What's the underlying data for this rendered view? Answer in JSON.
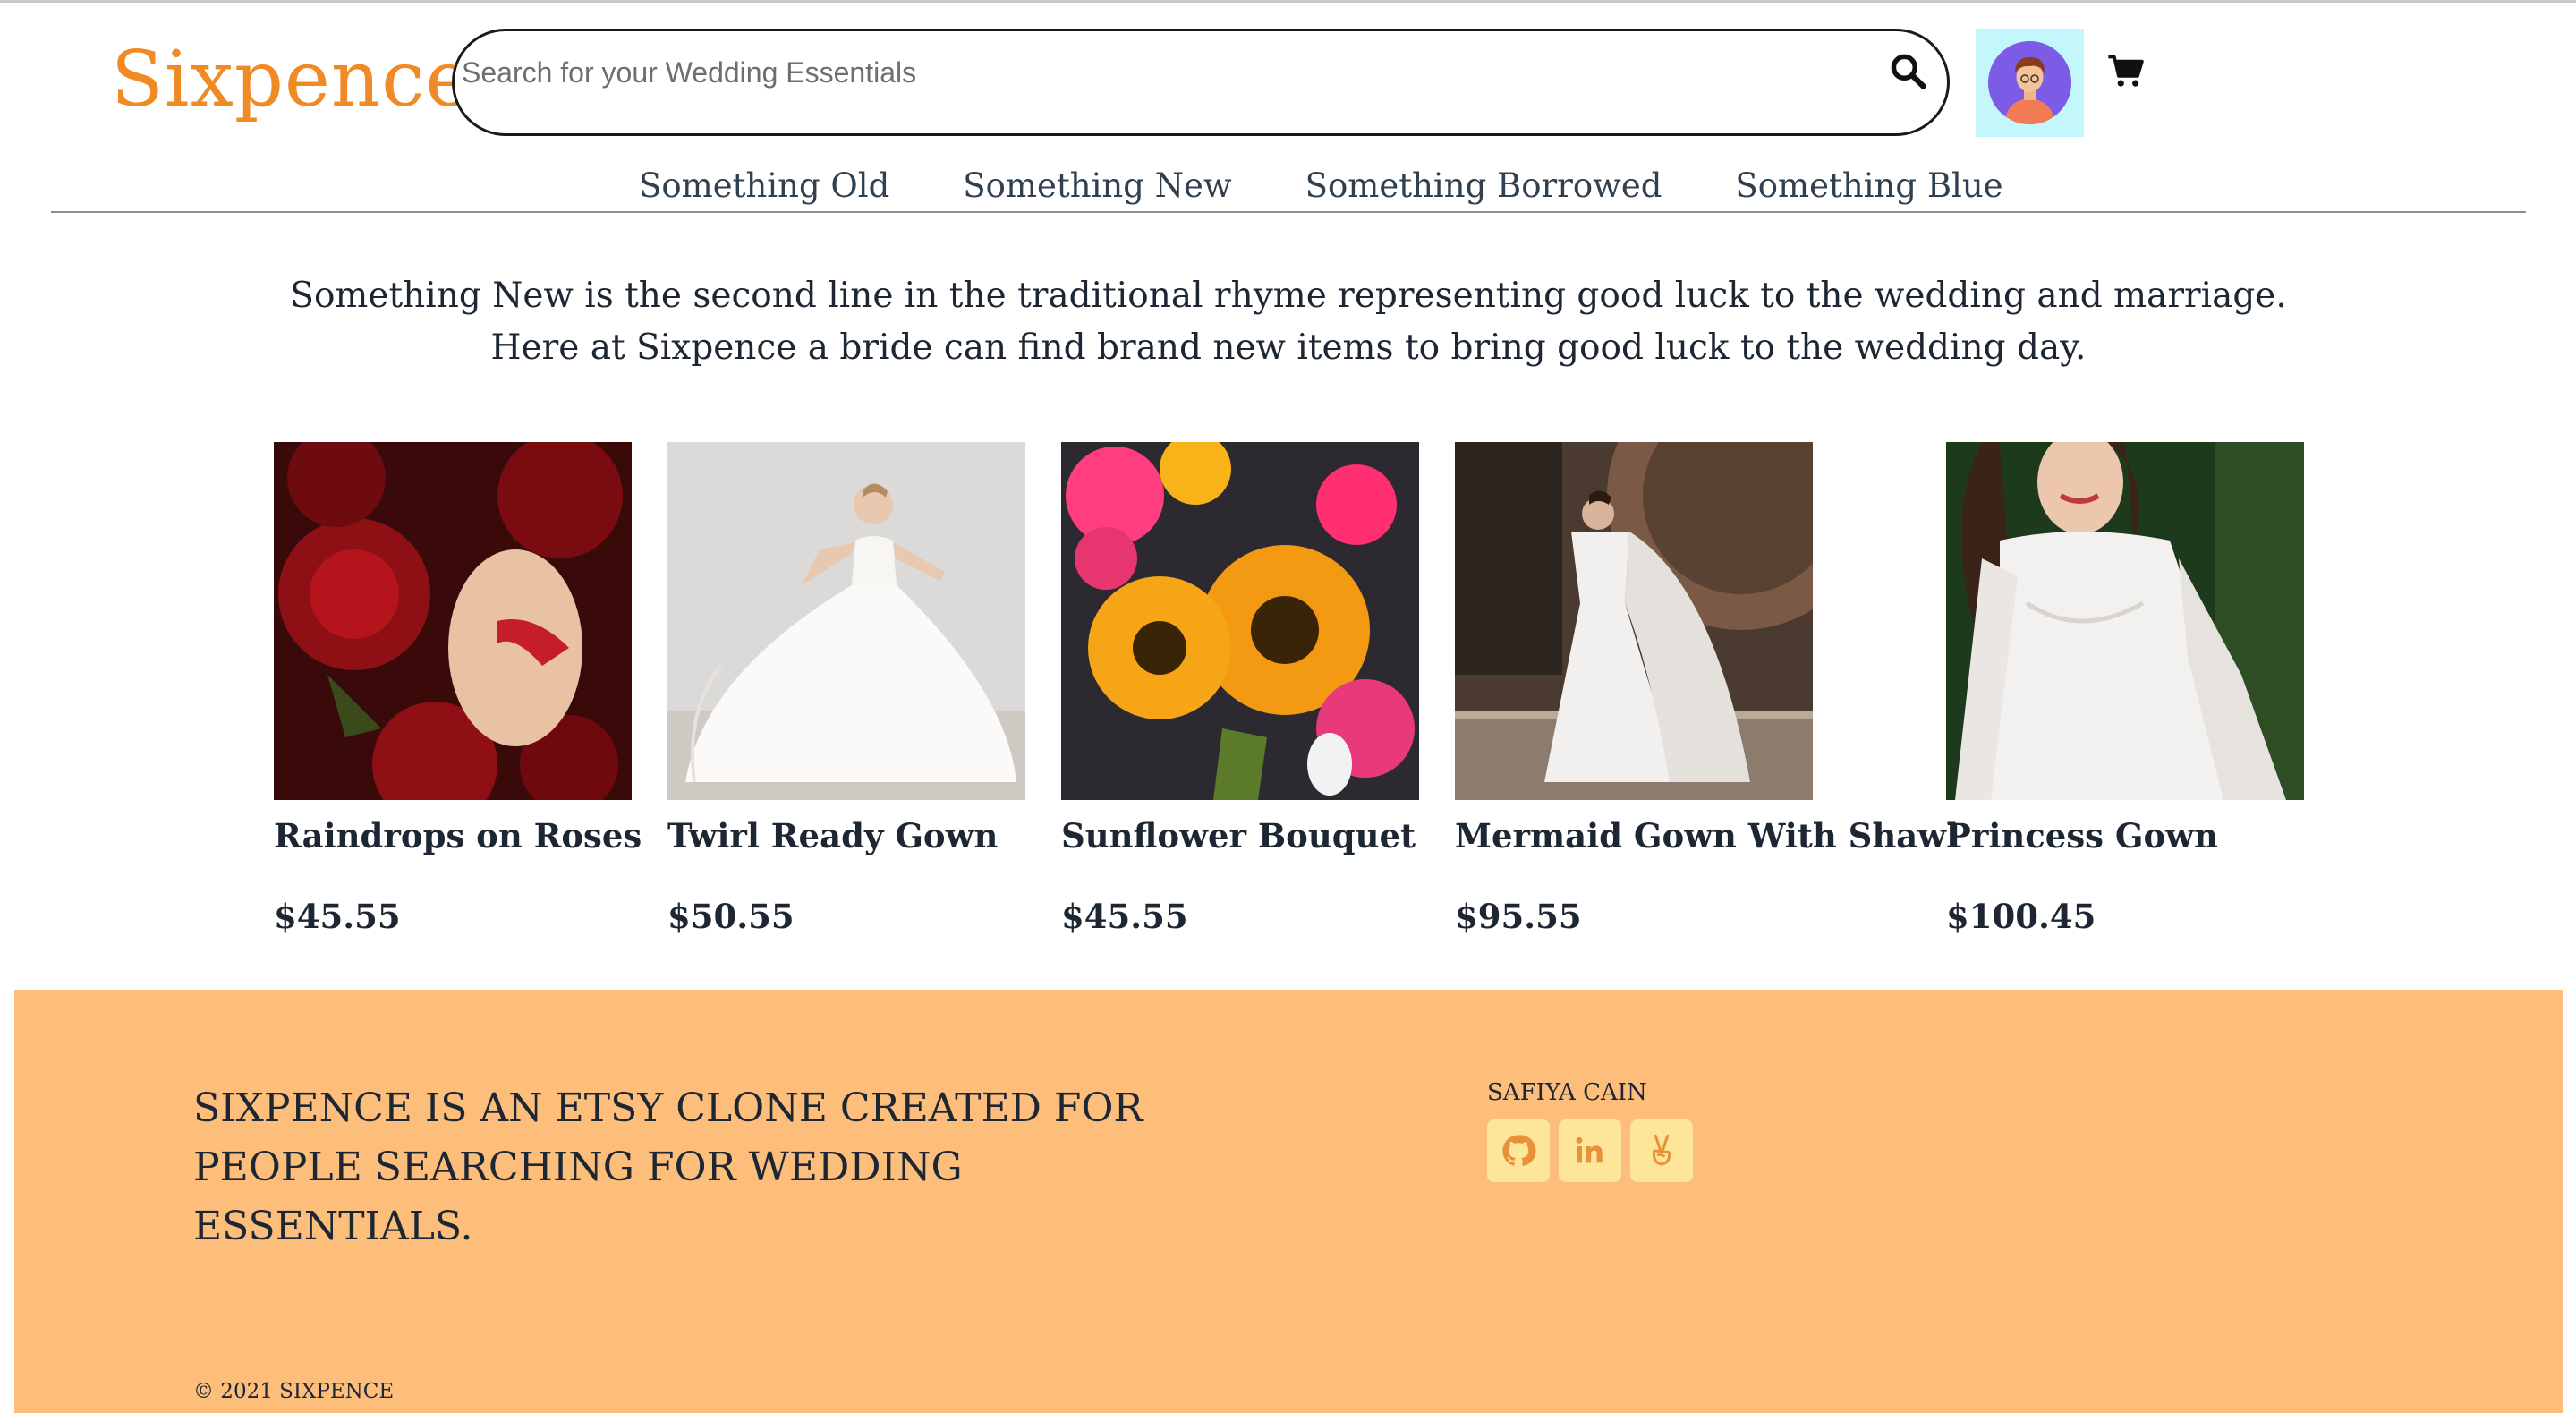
{
  "header": {
    "logo": "Sixpence",
    "search_placeholder": "Search for your Wedding Essentials",
    "search_icon": "search-icon",
    "avatar_icon": "user-avatar-icon",
    "cart_icon": "cart-icon"
  },
  "nav": {
    "items": [
      {
        "label": "Something Old"
      },
      {
        "label": "Something New"
      },
      {
        "label": "Something Borrowed"
      },
      {
        "label": "Something Blue"
      }
    ]
  },
  "intro": {
    "text": "Something New is the second line in the traditional rhyme representing good luck to the wedding and marriage. Here at Sixpence a bride can find brand new items to bring good luck to the wedding day."
  },
  "products": [
    {
      "name": "Raindrops on Roses",
      "price": "$45.55",
      "image": "red-roses-image"
    },
    {
      "name": "Twirl Ready Gown",
      "price": "$50.55",
      "image": "white-gown-image"
    },
    {
      "name": "Sunflower Bouquet",
      "price": "$45.55",
      "image": "sunflower-bouquet-image"
    },
    {
      "name": "Mermaid Gown With Shawl",
      "price": "$95.55",
      "image": "mermaid-gown-image"
    },
    {
      "name": "Princess Gown",
      "price": "$100.45",
      "image": "lace-gown-image"
    }
  ],
  "footer": {
    "tagline": "SIXPENCE IS AN ETSY CLONE CREATED FOR PEOPLE SEARCHING FOR WEDDING ESSENTIALS.",
    "author": "SAFIYA CAIN",
    "socials": [
      "github-icon",
      "linkedin-icon",
      "angellist-icon"
    ],
    "copyright": "© 2021 SIXPENCE"
  },
  "colors": {
    "brand": "#f08a24",
    "footer_bg": "#fdbd7b",
    "social_bg": "#fde59a",
    "avatar_bg": "#c4f7fb",
    "nav_text": "#2f4050"
  }
}
